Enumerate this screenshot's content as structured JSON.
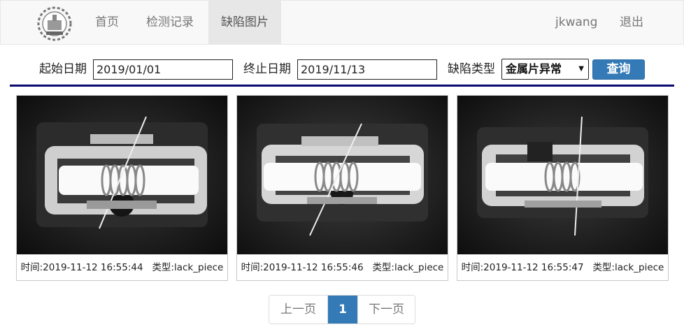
{
  "navbar": {
    "items": [
      {
        "label": "首页",
        "active": false
      },
      {
        "label": "检测记录",
        "active": false
      },
      {
        "label": "缺陷图片",
        "active": true
      }
    ],
    "user": "jkwang",
    "logout": "退出"
  },
  "search": {
    "start_label": "起始日期",
    "start_value": "2019/01/01",
    "end_label": "终止日期",
    "end_value": "2019/11/13",
    "type_label": "缺陷类型",
    "type_value": "金属片异常",
    "query_label": "查询"
  },
  "cards": [
    {
      "time": "时间:2019-11-12 16:55:44",
      "type": "类型:lack_piece"
    },
    {
      "time": "时间:2019-11-12 16:55:46",
      "type": "类型:lack_piece"
    },
    {
      "time": "时间:2019-11-12 16:55:47",
      "type": "类型:lack_piece"
    }
  ],
  "pager": {
    "prev": "上一页",
    "current": "1",
    "next": "下一页"
  }
}
